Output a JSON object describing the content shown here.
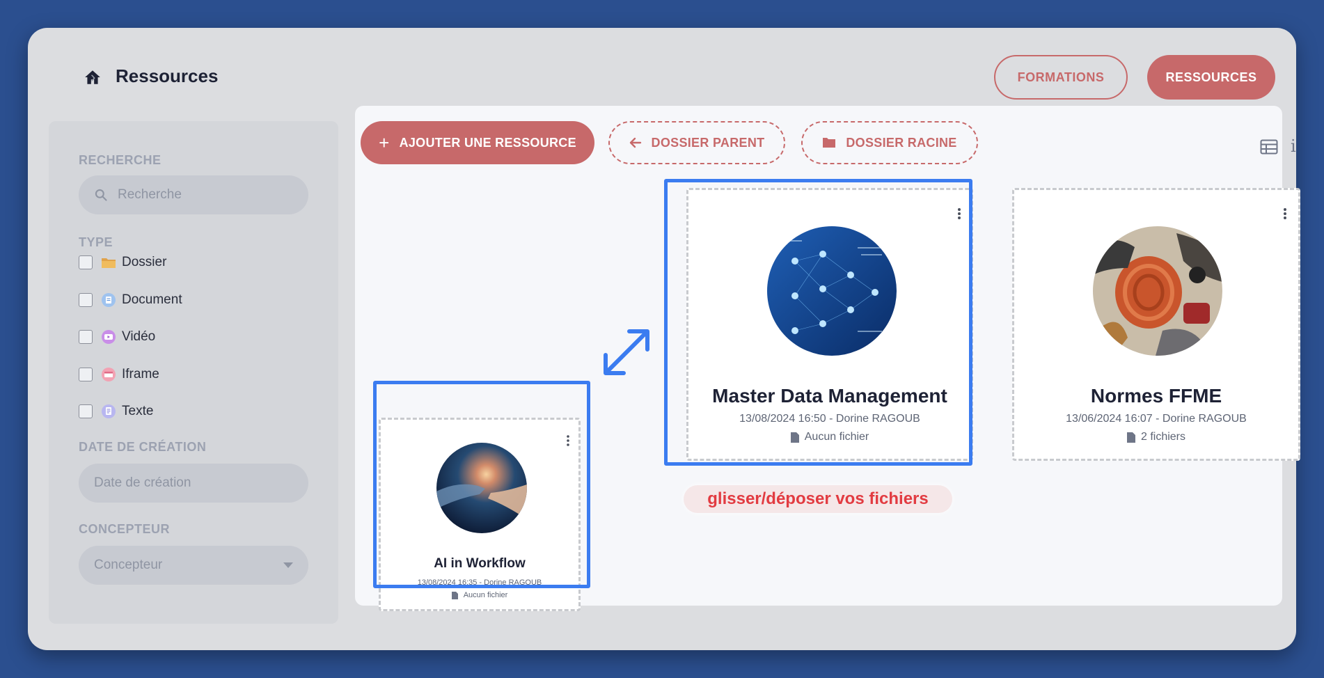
{
  "breadcrumb": {
    "title": "Ressources"
  },
  "header": {
    "formations_label": "FORMATIONS",
    "ressources_label": "RESSOURCES"
  },
  "sidebar": {
    "search_label": "RECHERCHE",
    "search_placeholder": "Recherche",
    "type_label": "TYPE",
    "types": [
      {
        "label": "Dossier",
        "icon": "folder-icon",
        "checked": false
      },
      {
        "label": "Document",
        "icon": "document-icon",
        "checked": false
      },
      {
        "label": "Vidéo",
        "icon": "video-icon",
        "checked": false
      },
      {
        "label": "Iframe",
        "icon": "iframe-icon",
        "checked": false
      },
      {
        "label": "Texte",
        "icon": "text-icon",
        "checked": false
      }
    ],
    "date_label": "DATE DE CRÉATION",
    "date_placeholder": "Date de création",
    "designer_label": "CONCEPTEUR",
    "designer_placeholder": "Concepteur"
  },
  "toolbar": {
    "add_label": "AJOUTER UNE RESSOURCE",
    "parent_label": "DOSSIER PARENT",
    "root_label": "DOSSIER RACINE"
  },
  "cards": [
    {
      "title": "AI in Workflow",
      "meta": "13/08/2024 16:35 - Dorine RAGOUB",
      "files": "Aucun fichier"
    },
    {
      "title": "Master Data Management",
      "meta": "13/08/2024 16:50 - Dorine RAGOUB",
      "files": "Aucun fichier"
    },
    {
      "title": "Normes FFME",
      "meta": "13/06/2024 16:07 - Dorine RAGOUB",
      "files": "2 fichiers"
    }
  ],
  "drop_hint": "glisser/déposer vos fichiers",
  "colors": {
    "accent": "#c7696a",
    "highlight": "#3b7cf0",
    "hint": "#e23b41",
    "background": "#2b4f8f"
  }
}
